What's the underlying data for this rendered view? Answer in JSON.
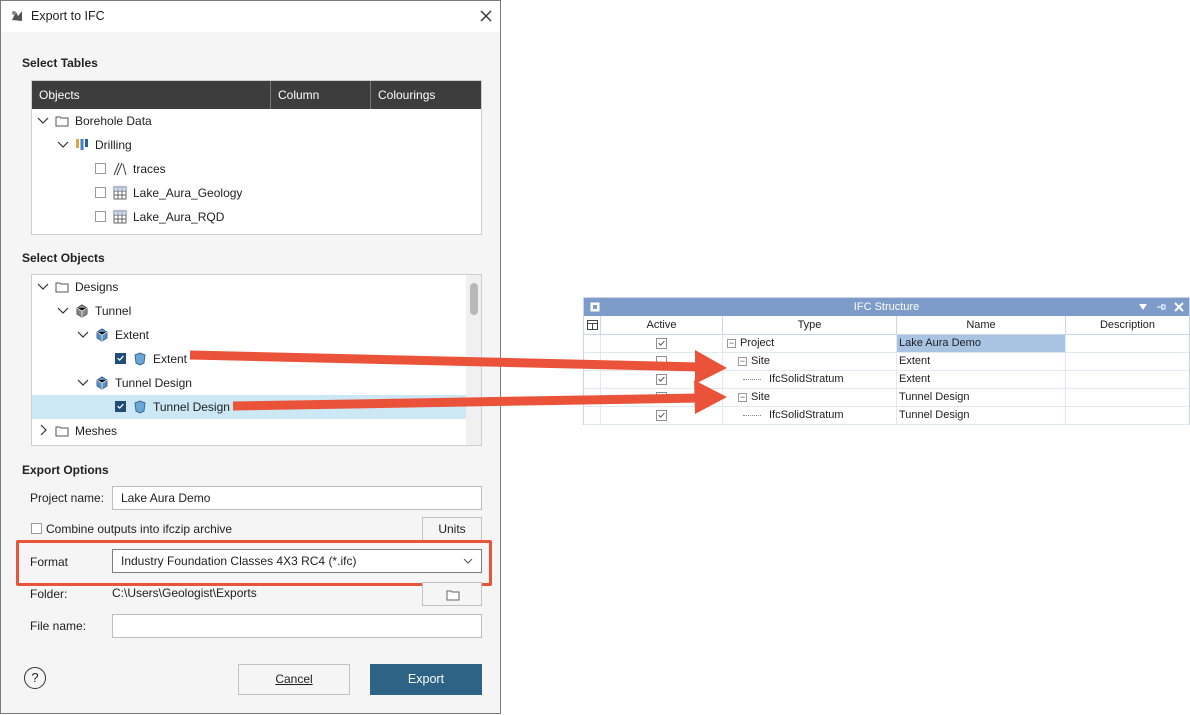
{
  "window": {
    "title": "Export to IFC"
  },
  "select_tables": {
    "label": "Select Tables",
    "columns": [
      "Objects",
      "Column",
      "Colourings"
    ],
    "rows": [
      {
        "label": "Borehole Data",
        "icon": "folder-icon",
        "expanded": true
      },
      {
        "label": "Drilling",
        "icon": "drilling-icon",
        "expanded": true
      },
      {
        "label": "traces",
        "icon": "traces-icon",
        "checked": false
      },
      {
        "label": "Lake_Aura_Geology",
        "icon": "table-icon",
        "checked": false
      },
      {
        "label": "Lake_Aura_RQD",
        "icon": "table-icon",
        "checked": false
      }
    ]
  },
  "select_objects": {
    "label": "Select Objects",
    "rows": [
      {
        "label": "Designs",
        "icon": "folder-icon",
        "expanded": true
      },
      {
        "label": "Tunnel",
        "icon": "tunnel-icon",
        "expanded": true
      },
      {
        "label": "Extent",
        "icon": "volume-icon",
        "expanded": true
      },
      {
        "label": "Extent",
        "icon": "solid-icon",
        "checked": true
      },
      {
        "label": "Tunnel Design",
        "icon": "volume-icon",
        "expanded": true
      },
      {
        "label": "Tunnel Design",
        "icon": "solid-icon",
        "checked": true,
        "selected": true
      },
      {
        "label": "Meshes",
        "icon": "folder-icon",
        "expanded": false
      }
    ]
  },
  "export_options": {
    "label": "Export Options",
    "project_name_label": "Project name:",
    "project_name_value": "Lake Aura Demo",
    "combine_label": "Combine outputs into ifczip archive",
    "combine_checked": false,
    "units_button": "Units",
    "format_label": "Format",
    "format_value": "Industry Foundation Classes 4X3 RC4 (*.ifc)",
    "folder_label": "Folder:",
    "folder_value": "C:\\Users\\Geologist\\Exports",
    "file_name_label": "File name:",
    "file_name_value": ""
  },
  "buttons": {
    "help": "?",
    "cancel": "Cancel",
    "export": "Export"
  },
  "ifc_structure": {
    "title": "IFC Structure",
    "columns": [
      "Active",
      "Type",
      "Name",
      "Description"
    ],
    "rows": [
      {
        "active": true,
        "type": "Project",
        "name": "Lake Aura Demo",
        "description": "",
        "level": 0,
        "node": "⊟",
        "highlight": true
      },
      {
        "active": false,
        "type": "Site",
        "name": "Extent",
        "description": "",
        "level": 1,
        "node": "⊟"
      },
      {
        "active": true,
        "type": "IfcSolidStratum",
        "name": "Extent",
        "description": "",
        "level": 2,
        "node": ""
      },
      {
        "active": false,
        "type": "Site",
        "name": "Tunnel Design",
        "description": "",
        "level": 1,
        "node": "⊟"
      },
      {
        "active": true,
        "type": "IfcSolidStratum",
        "name": "Tunnel Design",
        "description": "",
        "level": 2,
        "node": ""
      }
    ]
  },
  "colors": {
    "accent": "#2d6385",
    "highlight_frame": "#e8543a",
    "selection": "#cce8f5",
    "ifc_header": "#7d9cc9"
  }
}
